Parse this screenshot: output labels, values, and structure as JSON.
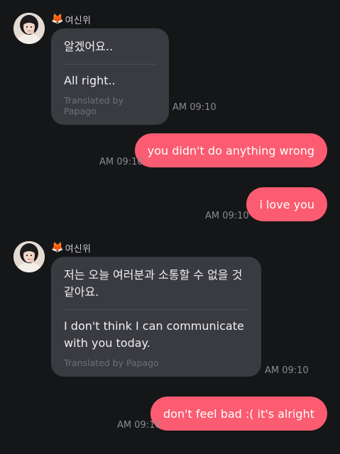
{
  "sender_name": "여신위",
  "messages": [
    {
      "original": "알겠어요..",
      "translation": "All right..",
      "credit": "Translated by Papago",
      "time": "AM 09:10"
    },
    {
      "text": "you didn't do anything wrong",
      "time": "AM 09:10"
    },
    {
      "text": "i love you",
      "time": "AM 09:10"
    },
    {
      "original": "저는 오늘 여러분과 소통할 수 없을 것 같아요.",
      "translation": "I don't think I can communicate with you today.",
      "credit": "Translated by Papago",
      "time": "AM 09:10"
    },
    {
      "text": "don't feel bad :( it's alright",
      "time": "AM 09:10"
    }
  ],
  "colors": {
    "background": "#151618",
    "incoming_bubble": "#3a3b40",
    "outgoing_bubble": "#fb5c71"
  },
  "icons": {
    "sender_badge": "fox-emoji"
  }
}
